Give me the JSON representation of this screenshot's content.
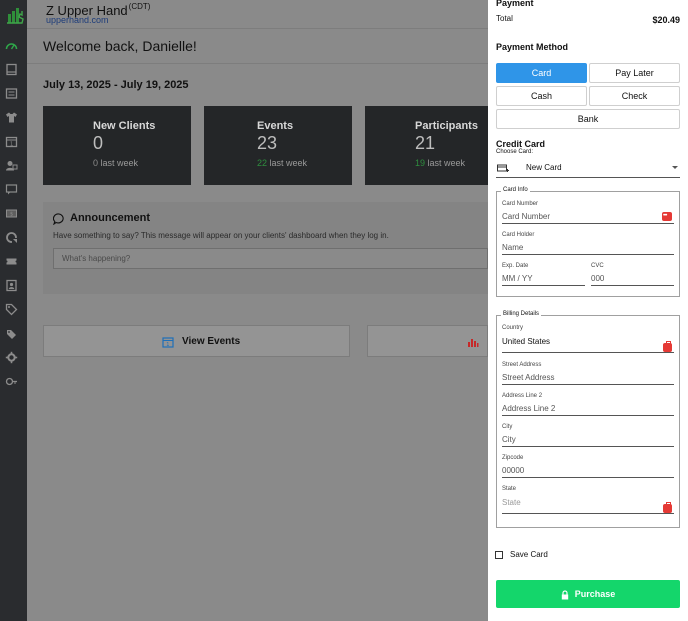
{
  "header": {
    "brand": "Z Upper Hand",
    "brand_tz": "(CDT)",
    "brand_sub": "upperhand.com"
  },
  "welcome": "Welcome back, Danielle!",
  "date_range": "July 13, 2025 - July 19, 2025",
  "stats": [
    {
      "label": "New Clients",
      "value": "0",
      "last_value": "0",
      "last_label": "last week",
      "last_color": "#8a8a8a"
    },
    {
      "label": "Events",
      "value": "23",
      "last_value": "22",
      "last_label": "last week",
      "last_color": "#2e8d3e"
    },
    {
      "label": "Participants",
      "value": "21",
      "last_value": "19",
      "last_label": "last week",
      "last_color": "#2e8d3e"
    }
  ],
  "announcement": {
    "title": "Announcement",
    "description": "Have something to say? This message will appear on your clients' dashboard when they log in.",
    "placeholder": "What's happening?"
  },
  "tiles": {
    "view_events": "View Events"
  },
  "sidebar_icons": [
    "dashboard-icon",
    "book-icon",
    "list-icon",
    "shirt-icon",
    "calendar-icon",
    "users-icon",
    "chat-icon",
    "cash-icon",
    "sync-icon",
    "ticket-icon",
    "contacts-icon",
    "tag-icon",
    "tags-icon",
    "gear-icon",
    "key-icon"
  ],
  "panel": {
    "payment_title": "Payment",
    "total_label": "Total",
    "total_value": "$20.49",
    "method_title": "Payment Method",
    "methods": [
      "Card",
      "Pay Later",
      "Cash",
      "Check",
      "Bank"
    ],
    "active_method": "Card",
    "credit_card_title": "Credit Card",
    "choose_card_label": "Choose Card:",
    "choose_card_value": "New Card",
    "card_info": {
      "legend": "Card Info",
      "card_number_label": "Card Number",
      "card_number_placeholder": "Card Number",
      "card_holder_label": "Card Holder",
      "card_holder_placeholder": "Name",
      "exp_label": "Exp. Date",
      "exp_placeholder": "MM / YY",
      "cvc_label": "CVC",
      "cvc_placeholder": "000"
    },
    "billing": {
      "legend": "Billing Details",
      "country_label": "Country",
      "country_value": "United States",
      "street_label": "Street Address",
      "street_placeholder": "Street Address",
      "line2_label": "Address Line 2",
      "line2_placeholder": "Address Line 2",
      "city_label": "City",
      "city_placeholder": "City",
      "zip_label": "Zipcode",
      "zip_placeholder": "00000",
      "state_label": "State",
      "state_placeholder": "State"
    },
    "save_card_label": "Save Card",
    "purchase_label": "Purchase"
  },
  "colors": {
    "accent_blue": "#2f95e8",
    "purchase_green": "#14d66b",
    "badge_red": "#e53935"
  }
}
